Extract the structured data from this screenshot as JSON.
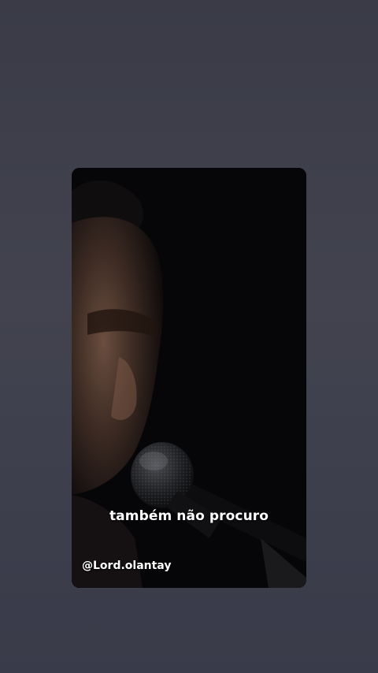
{
  "video": {
    "subtitle": "também não procuro",
    "watermark": "@Lord.olantay"
  },
  "colors": {
    "background": "#3d3e4b",
    "video_bg": "#060608",
    "text": "#ffffff"
  }
}
